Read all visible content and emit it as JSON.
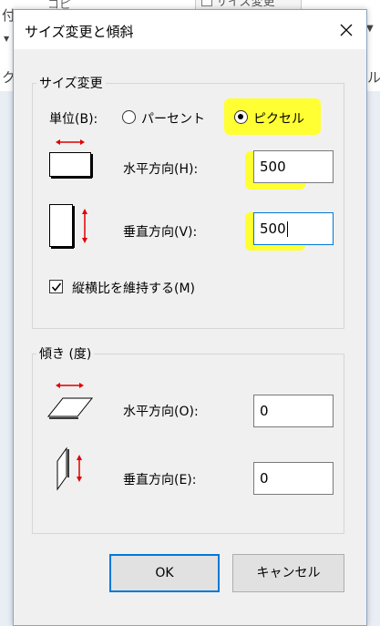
{
  "background": {
    "left_text_top": "付",
    "left_text_mid": "ク",
    "right_text": "ル",
    "button_label": "サイズ変更",
    "copy_label": "コピ"
  },
  "dialog": {
    "title": "サイズ変更と傾斜"
  },
  "resize": {
    "group_title": "サイズ変更",
    "unit_label": "単位(B):",
    "options": [
      {
        "label": "パーセント",
        "selected": false
      },
      {
        "label": "ピクセル",
        "selected": true
      }
    ],
    "horizontal_label": "水平方向(H):",
    "horizontal_value": "500",
    "vertical_label": "垂直方向(V):",
    "vertical_value": "500",
    "keep_ratio_label": "縦横比を維持する(M)",
    "keep_ratio_checked": true
  },
  "skew": {
    "group_title": "傾き (度)",
    "horizontal_label": "水平方向(O):",
    "horizontal_value": "0",
    "vertical_label": "垂直方向(E):",
    "vertical_value": "0"
  },
  "buttons": {
    "ok": "OK",
    "cancel": "キャンセル"
  },
  "colors": {
    "highlight": "#ffff33",
    "arrow": "#e00000",
    "focus": "#0078d7"
  }
}
